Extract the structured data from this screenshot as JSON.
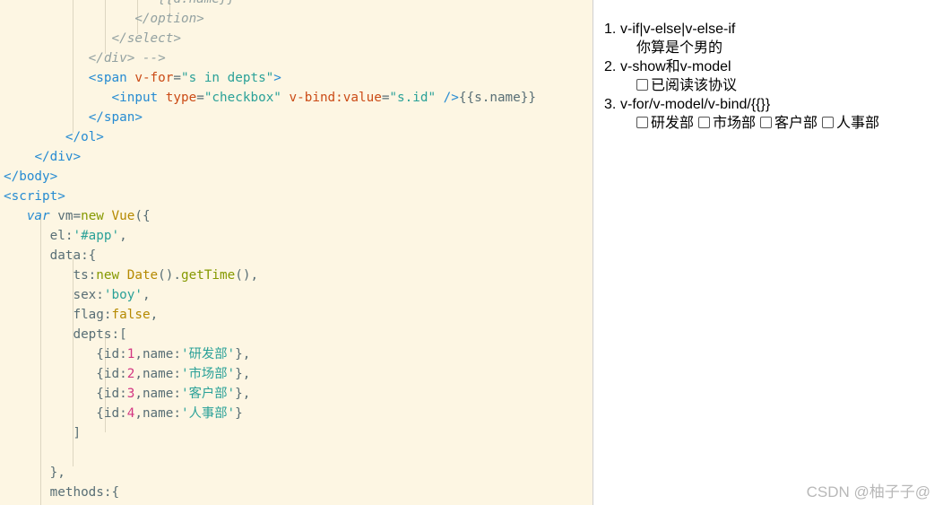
{
  "editor": {
    "lines": [
      [
        {
          "c": "t-com",
          "t": "                    {{d.name}}"
        }
      ],
      [
        {
          "c": "t-com",
          "t": "                 </option>"
        }
      ],
      [
        {
          "c": "t-com",
          "t": "              </select>"
        }
      ],
      [
        {
          "c": "t-com",
          "t": "           </div> -->"
        }
      ],
      [
        {
          "c": "t-plain",
          "t": "           "
        },
        {
          "c": "t-tag",
          "t": "<span "
        },
        {
          "c": "t-attr",
          "t": "v-for"
        },
        {
          "c": "t-plain",
          "t": "="
        },
        {
          "c": "t-str",
          "t": "\"s in depts\""
        },
        {
          "c": "t-tag",
          "t": ">"
        }
      ],
      [
        {
          "c": "t-plain",
          "t": "              "
        },
        {
          "c": "t-tag",
          "t": "<input "
        },
        {
          "c": "t-attr",
          "t": "type"
        },
        {
          "c": "t-plain",
          "t": "="
        },
        {
          "c": "t-str",
          "t": "\"checkbox\" "
        },
        {
          "c": "t-attr",
          "t": "v-bind:value"
        },
        {
          "c": "t-plain",
          "t": "="
        },
        {
          "c": "t-str",
          "t": "\"s.id\""
        },
        {
          "c": "t-tag",
          "t": " />"
        },
        {
          "c": "t-plain",
          "t": "{{s.name}}"
        }
      ],
      [
        {
          "c": "t-plain",
          "t": "           "
        },
        {
          "c": "t-tag",
          "t": "</span>"
        }
      ],
      [
        {
          "c": "t-plain",
          "t": "        "
        },
        {
          "c": "t-tag",
          "t": "</ol>"
        }
      ],
      [
        {
          "c": "t-plain",
          "t": "    "
        },
        {
          "c": "t-tag",
          "t": "</div>"
        }
      ],
      [
        {
          "c": "t-tag",
          "t": "</body>"
        }
      ],
      [
        {
          "c": "t-tag",
          "t": "<script>"
        }
      ],
      [
        {
          "c": "t-plain",
          "t": "   "
        },
        {
          "c": "t-kwi",
          "t": "var "
        },
        {
          "c": "t-plain",
          "t": "vm="
        },
        {
          "c": "t-kw",
          "t": "new "
        },
        {
          "c": "t-cls",
          "t": "Vue"
        },
        {
          "c": "t-plain",
          "t": "({"
        }
      ],
      [
        {
          "c": "t-plain",
          "t": "      el:"
        },
        {
          "c": "t-str",
          "t": "'#app'"
        },
        {
          "c": "t-plain",
          "t": ","
        }
      ],
      [
        {
          "c": "t-plain",
          "t": "      data:{"
        }
      ],
      [
        {
          "c": "t-plain",
          "t": "         ts:"
        },
        {
          "c": "t-kw",
          "t": "new "
        },
        {
          "c": "t-cls",
          "t": "Date"
        },
        {
          "c": "t-plain",
          "t": "()."
        },
        {
          "c": "t-fn",
          "t": "getTime"
        },
        {
          "c": "t-plain",
          "t": "(),"
        }
      ],
      [
        {
          "c": "t-plain",
          "t": "         sex:"
        },
        {
          "c": "t-str",
          "t": "'boy'"
        },
        {
          "c": "t-plain",
          "t": ","
        }
      ],
      [
        {
          "c": "t-plain",
          "t": "         flag:"
        },
        {
          "c": "t-bool",
          "t": "false"
        },
        {
          "c": "t-plain",
          "t": ","
        }
      ],
      [
        {
          "c": "t-plain",
          "t": "         depts:["
        }
      ],
      [
        {
          "c": "t-plain",
          "t": "            {id:"
        },
        {
          "c": "t-num",
          "t": "1"
        },
        {
          "c": "t-plain",
          "t": ",name:"
        },
        {
          "c": "t-str",
          "t": "'研发部'"
        },
        {
          "c": "t-plain",
          "t": "},"
        }
      ],
      [
        {
          "c": "t-plain",
          "t": "            {id:"
        },
        {
          "c": "t-num",
          "t": "2"
        },
        {
          "c": "t-plain",
          "t": ",name:"
        },
        {
          "c": "t-str",
          "t": "'市场部'"
        },
        {
          "c": "t-plain",
          "t": "},"
        }
      ],
      [
        {
          "c": "t-plain",
          "t": "            {id:"
        },
        {
          "c": "t-num",
          "t": "3"
        },
        {
          "c": "t-plain",
          "t": ",name:"
        },
        {
          "c": "t-str",
          "t": "'客户部'"
        },
        {
          "c": "t-plain",
          "t": "},"
        }
      ],
      [
        {
          "c": "t-plain",
          "t": "            {id:"
        },
        {
          "c": "t-num",
          "t": "4"
        },
        {
          "c": "t-plain",
          "t": ",name:"
        },
        {
          "c": "t-str",
          "t": "'人事部'"
        },
        {
          "c": "t-plain",
          "t": "}"
        }
      ],
      [
        {
          "c": "t-plain",
          "t": "         ]"
        }
      ],
      [
        {
          "c": "t-plain",
          "t": ""
        }
      ],
      [
        {
          "c": "t-plain",
          "t": "      },"
        }
      ],
      [
        {
          "c": "t-plain",
          "t": "      methods:{"
        }
      ]
    ]
  },
  "preview": {
    "items": [
      {
        "num": "1.",
        "label": "v-if|v-else|v-else-if",
        "sub_text": "你算是个男的"
      },
      {
        "num": "2.",
        "label": "v-show和v-model",
        "checkbox_label": "已阅读该协议"
      },
      {
        "num": "3.",
        "label": "v-for/v-model/v-bind/{{}}",
        "depts": [
          "研发部",
          "市场部",
          "客户部",
          "人事部"
        ]
      }
    ]
  },
  "watermark": "CSDN @柚子子@"
}
